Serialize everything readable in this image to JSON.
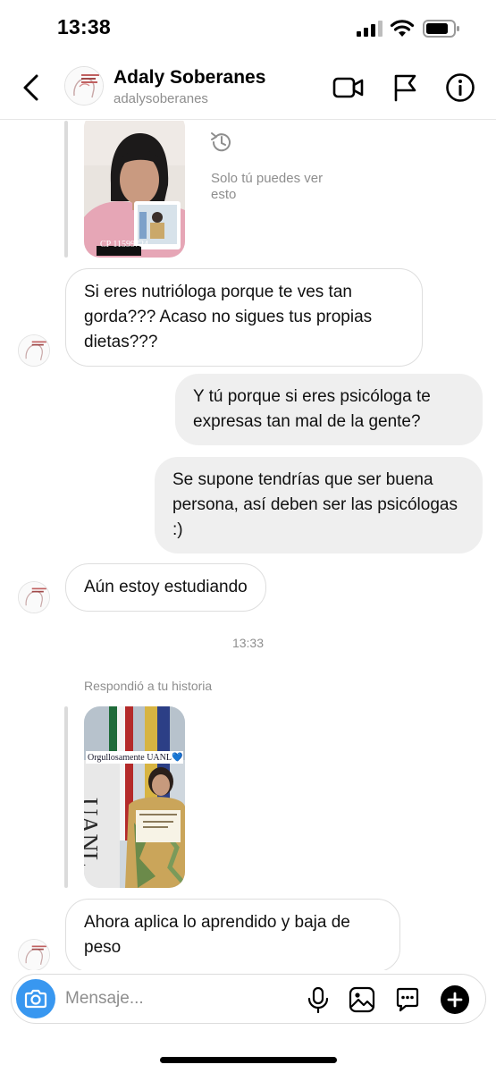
{
  "status_bar": {
    "time": "13:38"
  },
  "header": {
    "contact_name": "Adaly Soberanes",
    "contact_username": "adalysoberanes"
  },
  "thread": {
    "story_1": {
      "badge": "CP 11599724"
    },
    "only_you": "Solo tú puedes ver esto",
    "messages": [
      {
        "from": "them",
        "text": "Si eres nutrióloga porque te ves tan gorda??? Acaso no sigues tus propias dietas???"
      },
      {
        "from": "me",
        "text": "Y tú porque si eres psicóloga te expresas tan mal de la gente?"
      },
      {
        "from": "me",
        "text": "Se supone tendrías que ser buena persona, así deben ser las psicólogas :)"
      },
      {
        "from": "them",
        "text": "Aún estoy estudiando"
      },
      {
        "from": "them",
        "text": "Ahora aplica lo aprendido y baja de peso"
      }
    ],
    "timestamp": "13:33",
    "reply_note": "Respondió a tu historia",
    "story_2": {
      "caption": "Orgullosamente UANL💙",
      "wall_text": "UANL"
    }
  },
  "composer": {
    "placeholder": "Mensaje..."
  },
  "colors": {
    "accent": "#3897f0",
    "bubble_out": "#efefef",
    "bubble_in_border": "#dedede",
    "muted_text": "#8e8e8e"
  },
  "icons": [
    "back-arrow-icon",
    "video-call-icon",
    "flag-icon",
    "info-icon",
    "history-icon",
    "camera-icon",
    "microphone-icon",
    "gallery-icon",
    "sticker-icon",
    "plus-icon"
  ]
}
